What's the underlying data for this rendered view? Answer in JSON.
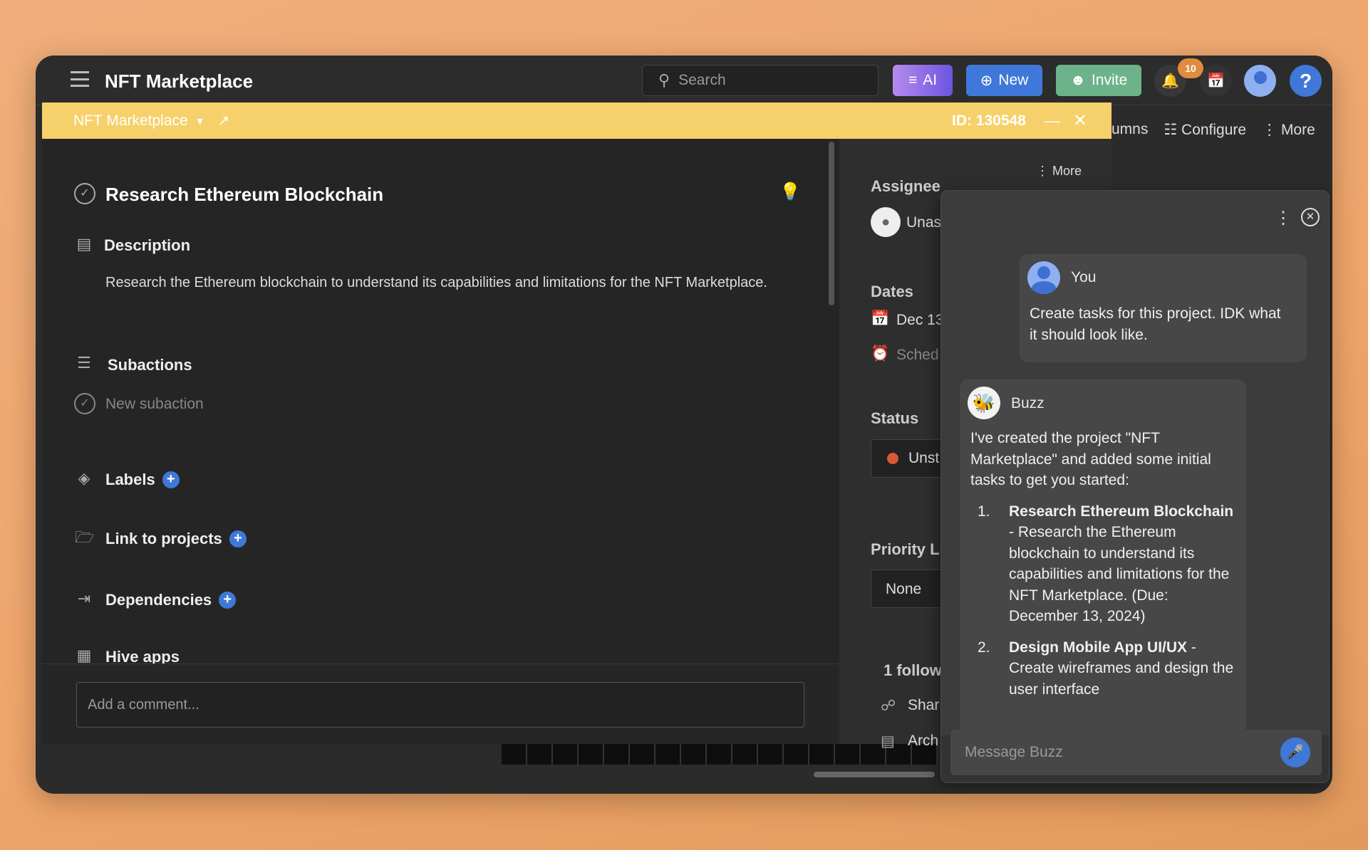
{
  "app": {
    "title": "NFT Marketplace"
  },
  "topbar": {
    "search_placeholder": "Search",
    "ai_label": "AI",
    "new_label": "New",
    "invite_label": "Invite",
    "notifications_count": "10",
    "help_label": "?"
  },
  "background_toolbar": {
    "columns_label": "umns",
    "configure_label": "Configure",
    "more_label": "More"
  },
  "task_header": {
    "project": "NFT Marketplace",
    "id": "ID: 130548"
  },
  "task": {
    "title": "Research Ethereum Blockchain",
    "description_heading": "Description",
    "description": "Research the Ethereum blockchain to understand its capabilities and limitations for the NFT Marketplace.",
    "subactions_heading": "Subactions",
    "new_subaction": "New subaction",
    "labels": "Labels",
    "link_to_projects": "Link to projects",
    "dependencies": "Dependencies",
    "hive_apps": "Hive apps",
    "comment_placeholder": "Add a comment..."
  },
  "sidebar": {
    "more": "More",
    "assignee_heading": "Assignee",
    "assignee": "Unas",
    "dates_heading": "Dates",
    "date": "Dec 13",
    "schedule": "Sched",
    "status_heading": "Status",
    "status": "Unst",
    "status_color": "#d9583a",
    "priority_heading": "Priority L",
    "priority": "None",
    "followers": "1 follow",
    "share": "Shar",
    "archive": "Arch"
  },
  "chat": {
    "user_name": "You",
    "user_message": "Create tasks for this project. IDK what it should look like.",
    "bot_name": "Buzz",
    "bot_intro": "I've created the project \"NFT Marketplace\" and added some initial tasks to get you started:",
    "tasks": [
      {
        "num": "1.",
        "title": "Research Ethereum Blockchain",
        "text": " - Research the Ethereum blockchain to understand its capabilities and limitations for the NFT Marketplace. (Due: December 13, 2024)"
      },
      {
        "num": "2.",
        "title": "Design Mobile App UI/UX",
        "text": " - Create wireframes and design the user interface"
      }
    ],
    "input_placeholder": "Message Buzz"
  },
  "colors": {
    "ai": "#7b5ee0",
    "new": "#3f78d8",
    "invite": "#6db38a",
    "badge": "#e08b3e",
    "header": "#f6d06b"
  }
}
